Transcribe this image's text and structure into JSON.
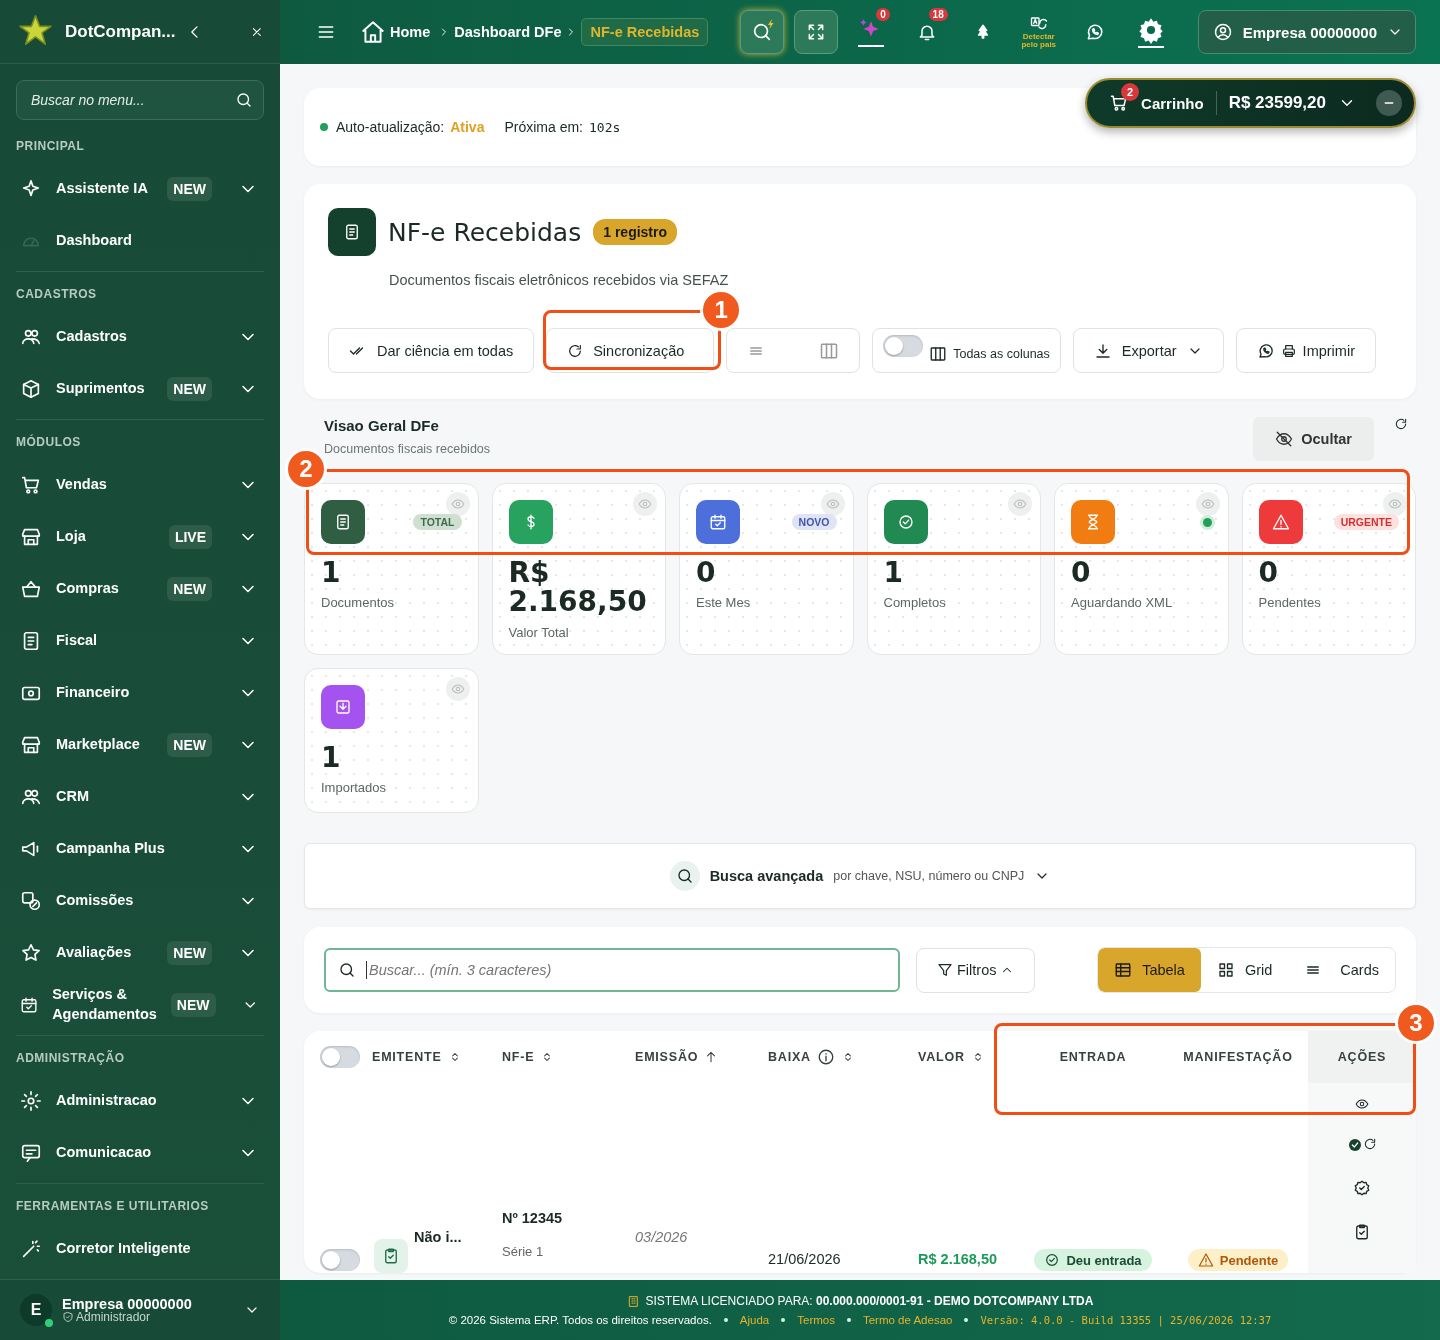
{
  "sidebar": {
    "brand": "DotCompan...",
    "search": {
      "placeholder": "Buscar no menu..."
    },
    "sections": [
      {
        "title": "PRINCIPAL",
        "items": [
          {
            "label": "Assistente IA",
            "badge": "NEW",
            "submenu": true
          },
          {
            "label": "Dashboard",
            "submenu": false
          }
        ]
      },
      {
        "title": "CADASTROS",
        "items": [
          {
            "label": "Cadastros",
            "submenu": true
          },
          {
            "label": "Suprimentos",
            "badge": "NEW",
            "submenu": true
          }
        ]
      },
      {
        "title": "MÓDULOS",
        "items": [
          {
            "label": "Vendas",
            "submenu": true
          },
          {
            "label": "Loja",
            "badge": "LIVE",
            "submenu": true
          },
          {
            "label": "Compras",
            "badge": "NEW",
            "submenu": true
          },
          {
            "label": "Fiscal",
            "submenu": true
          },
          {
            "label": "Financeiro",
            "submenu": true
          },
          {
            "label": "Marketplace",
            "badge": "NEW",
            "submenu": true
          },
          {
            "label": "CRM",
            "submenu": true
          },
          {
            "label": "Campanha Plus",
            "submenu": true
          },
          {
            "label": "Comissões",
            "submenu": true
          },
          {
            "label": "Avaliações",
            "badge": "NEW",
            "submenu": true
          },
          {
            "label": "Serviços & Agendamentos",
            "badge": "NEW",
            "submenu": true
          }
        ]
      },
      {
        "title": "ADMINISTRAÇÃO",
        "items": [
          {
            "label": "Administracao",
            "submenu": true
          },
          {
            "label": "Comunicacao",
            "submenu": true
          }
        ]
      },
      {
        "title": "FERRAMENTAS E UTILITARIOS",
        "items": [
          {
            "label": "Corretor Inteligente",
            "submenu": false
          }
        ]
      }
    ],
    "user": {
      "initial": "E",
      "name": "Empresa 00000000",
      "role": "Administrador"
    }
  },
  "topbar": {
    "breadcrumb": [
      {
        "label": "Home",
        "current": false
      },
      {
        "label": "Dashboard DFe",
        "current": false
      },
      {
        "label": "NF-e Recebidas",
        "current": true
      }
    ],
    "ai_count": "0",
    "notifications_count": "18",
    "language_hint": "Detectar pelo pais",
    "account": "Empresa 00000000"
  },
  "cart": {
    "count": "2",
    "label": "Carrinho",
    "total": "R$ 23599,20"
  },
  "auto_update": {
    "label": "Auto-atualização:",
    "status": "Ativa",
    "next_label": "Próxima em:",
    "next_value": "102s"
  },
  "header": {
    "title": "NF-e Recebidas",
    "badge": "1 registro",
    "subtitle": "Documentos fiscais eletrônicos recebidos via SEFAZ",
    "actions": [
      {
        "kind": "ciencia",
        "label": "Dar ciência em todas"
      },
      {
        "kind": "sync",
        "label": "Sincronização"
      },
      {
        "kind": "density"
      },
      {
        "kind": "columns",
        "label": "Todas as colunas",
        "on": false
      },
      {
        "kind": "export",
        "label": "Exportar"
      },
      {
        "kind": "print",
        "label": "Imprimir"
      }
    ]
  },
  "overview": {
    "title": "Visao Geral DFe",
    "subtitle": "Documentos fiscais recebidos",
    "hide_label": "Ocultar",
    "stats": [
      {
        "kind": "doc",
        "value": "1",
        "label": "Documentos",
        "tag": "TOTAL",
        "color": "#2f5e43"
      },
      {
        "kind": "money",
        "value": "R$ 2.168,50",
        "label": "Valor Total",
        "color": "#27a35f"
      },
      {
        "kind": "calendar",
        "value": "0",
        "label": "Este Mes",
        "tag": "NOVO",
        "color": "#4d6fdc"
      },
      {
        "kind": "check",
        "value": "1",
        "label": "Completos",
        "color": "#208a52"
      },
      {
        "kind": "hourglass",
        "value": "0",
        "label": "Aguardando XML",
        "indicator": true,
        "color": "#f07c12"
      },
      {
        "kind": "alert",
        "value": "0",
        "label": "Pendentes",
        "tag": "URGENTE",
        "color": "#ee3a3a"
      },
      {
        "kind": "import",
        "value": "1",
        "label": "Importados",
        "color": "#a452f0"
      }
    ]
  },
  "advanced_search": {
    "label": "Busca avançada",
    "hint": "por chave, NSU, número ou CNPJ"
  },
  "search": {
    "placeholder": "Buscar... (mín. 3 caracteres)",
    "filters": "Filtros",
    "views": [
      {
        "kind": "table",
        "label": "Tabela",
        "selected": true
      },
      {
        "kind": "grid",
        "label": "Grid",
        "selected": false
      },
      {
        "kind": "cards",
        "label": "Cards",
        "selected": false
      }
    ]
  },
  "table": {
    "select_all": false,
    "columns": [
      {
        "label": "EMITENTE",
        "sortable": true,
        "sorted_ascending": false
      },
      {
        "label": "NF-E",
        "sortable": true,
        "sorted_ascending": false
      },
      {
        "label": "EMISSÃO",
        "sortable": true,
        "sorted_ascending": true
      },
      {
        "label": "BAIXA",
        "sortable": true,
        "sorted_ascending": false,
        "info": true
      },
      {
        "label": "VALOR",
        "sortable": true,
        "sorted_ascending": false
      },
      {
        "label": "ENTRADA"
      },
      {
        "label": "MANIFESTAÇÃO"
      },
      {
        "label": "AÇÕES"
      }
    ],
    "rows": [
      {
        "selected": false,
        "emitente": "Não i...",
        "number": "Nº 12345",
        "series": "Série 1",
        "emissao": "03/2026",
        "baixa": "21/06/2026",
        "valor": "R$ 2.168,50",
        "entrada": {
          "kind": "success",
          "label": "Deu entrada"
        },
        "manifestacao": {
          "kind": "warning",
          "label": "Pendente"
        }
      }
    ]
  },
  "footer": {
    "license": "SISTEMA LICENCIADO PARA: **00.000.000/0001-91 - DEMO DOTCOMPANY LTDA**",
    "copyright": "© 2026 Sistema ERP. Todos os direitos reservados.",
    "links": [
      "Ajuda",
      "Termos",
      "Termo de Adesao"
    ],
    "version": "Versão: 4.0.0 - Build 13355 | 25/06/2026 12:37"
  },
  "annotations": [
    {
      "number": "1"
    },
    {
      "number": "2"
    },
    {
      "number": "3"
    }
  ]
}
